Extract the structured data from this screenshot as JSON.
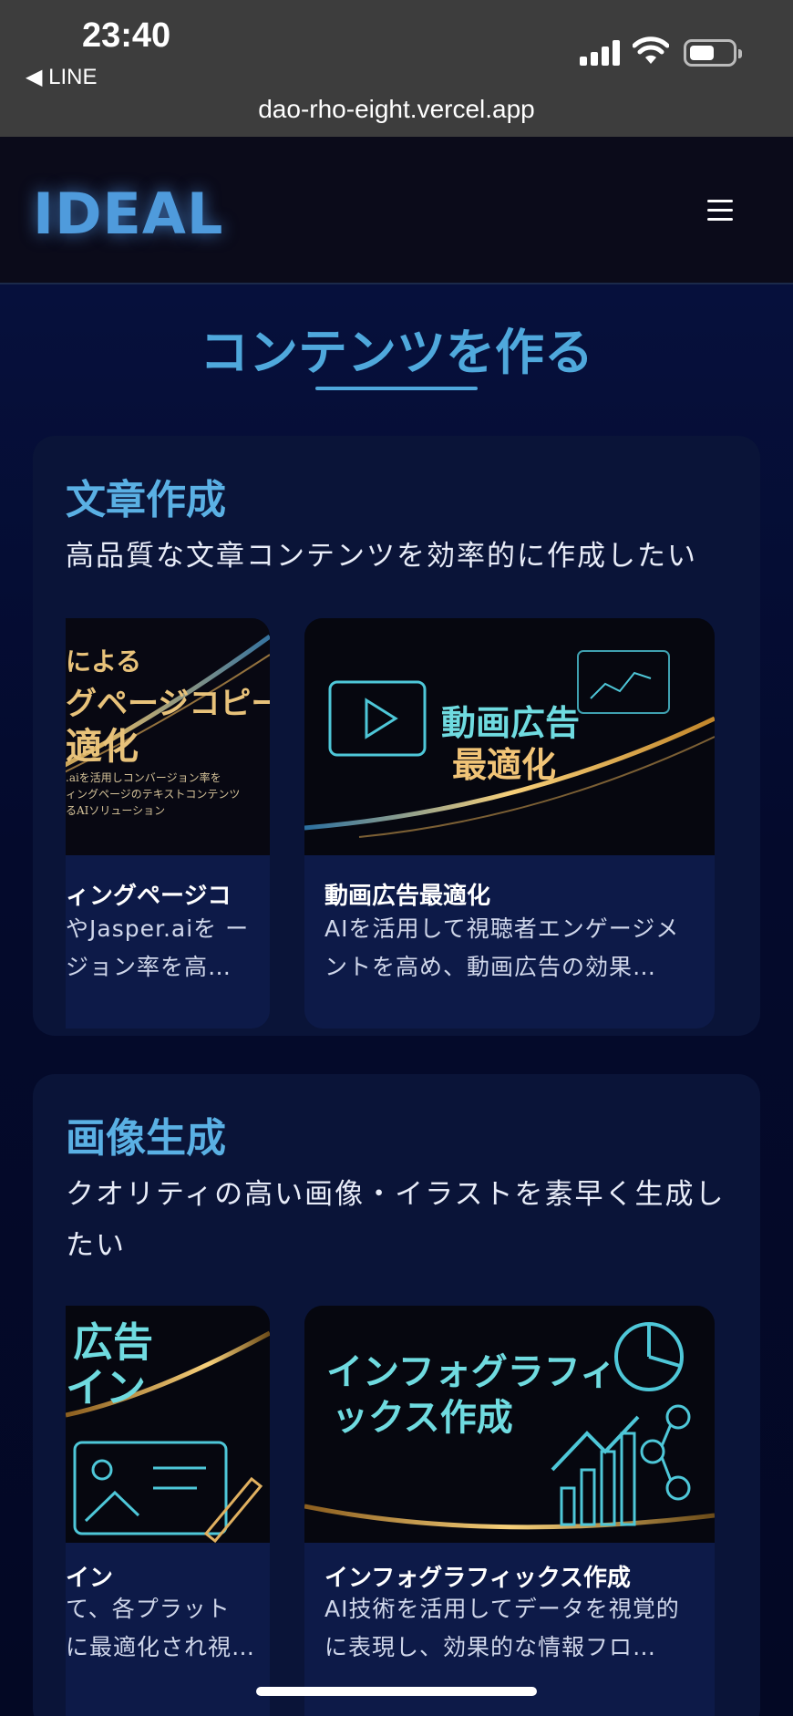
{
  "status_bar": {
    "time": "23:40",
    "back_app": "◀ LINE",
    "url": "dao-rho-eight.vercel.app"
  },
  "header": {
    "logo": "IDEAL",
    "menu_icon": "hamburger-menu-icon"
  },
  "section": {
    "title": "コンテンツを作る"
  },
  "categories": [
    {
      "title": "文章作成",
      "description": "高品質な文章コンテンツを効率的に作成したい",
      "items": [
        {
          "thumb_lines": [
            "による",
            "グページコピー",
            "適化"
          ],
          "thumb_small": [
            ".aiを活用しコンバージョン率を",
            "ィングページのテキストコンテンツ",
            "るAIソリューション"
          ],
          "title": "ィングページコ",
          "description": "やJasper.aiを ージョン率を高…"
        },
        {
          "thumb_lines": [
            "動画広告",
            "最適化"
          ],
          "title": "動画広告最適化",
          "description": "AIを活用して視聴者エンゲージメントを高め、動画広告の効果…"
        }
      ]
    },
    {
      "title": "画像生成",
      "description": "クオリティの高い画像・イラストを素早く生成したい",
      "items": [
        {
          "thumb_lines": [
            "広告",
            "イン"
          ],
          "title": "イン",
          "description": "て、各プラット に最適化され視…"
        },
        {
          "thumb_lines": [
            "インフォグラフィ",
            "ックス作成"
          ],
          "title": "インフォグラフィックス作成",
          "description": "AI技術を活用してデータを視覚的に表現し、効果的な情報フロ…"
        }
      ]
    }
  ],
  "colors": {
    "accent": "#4fa8dc",
    "background": "#04081f",
    "card": "#0a1438",
    "gold": "#e8b85a",
    "cyan": "#5fd3e0"
  }
}
